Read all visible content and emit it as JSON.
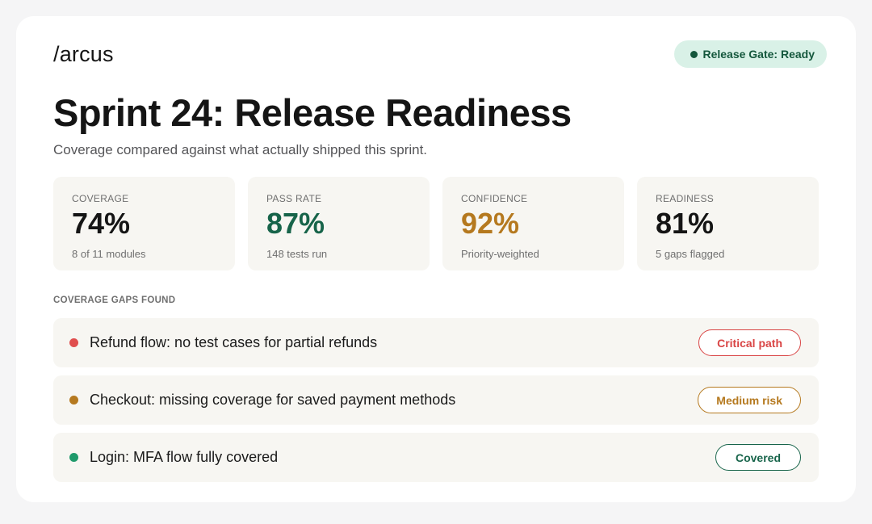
{
  "brand": "/arcus",
  "gate": {
    "label": "Release Gate: Ready",
    "color": "#14573c",
    "bg": "#d9f1e7"
  },
  "title": "Sprint 24: Release Readiness",
  "subtitle": "Coverage compared against what actually shipped this sprint.",
  "stats": [
    {
      "label": "COVERAGE",
      "value": "74%",
      "note": "8 of 11 modules",
      "color": "#151515"
    },
    {
      "label": "PASS RATE",
      "value": "87%",
      "note": "148 tests run",
      "color": "#17644a"
    },
    {
      "label": "CONFIDENCE",
      "value": "92%",
      "note": "Priority-weighted",
      "color": "#b5791f"
    },
    {
      "label": "READINESS",
      "value": "81%",
      "note": "5 gaps flagged",
      "color": "#151515"
    }
  ],
  "section_label": "COVERAGE GAPS FOUND",
  "gaps": [
    {
      "text": "Refund flow: no test cases for partial refunds",
      "badge": "Critical path",
      "color": "#e04e4e",
      "badge_color": "#d94545"
    },
    {
      "text": "Checkout: missing coverage for saved payment methods",
      "badge": "Medium risk",
      "color": "#b5791f",
      "badge_color": "#b5791f"
    },
    {
      "text": "Login: MFA flow fully covered",
      "badge": "Covered",
      "color": "#1f9a6b",
      "badge_color": "#17644a"
    }
  ]
}
